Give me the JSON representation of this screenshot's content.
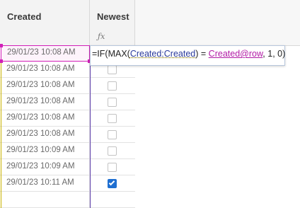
{
  "columns": {
    "created": {
      "label": "Created"
    },
    "newest": {
      "label": "Newest",
      "icon": "fx-formula-icon"
    }
  },
  "rows": [
    {
      "created": "29/01/23 10:08 AM",
      "newest": null
    },
    {
      "created": "29/01/23 10:08 AM",
      "newest": false
    },
    {
      "created": "29/01/23 10:08 AM",
      "newest": false
    },
    {
      "created": "29/01/23 10:08 AM",
      "newest": false
    },
    {
      "created": "29/01/23 10:08 AM",
      "newest": false
    },
    {
      "created": "29/01/23 10:08 AM",
      "newest": false
    },
    {
      "created": "29/01/23 10:09 AM",
      "newest": false
    },
    {
      "created": "29/01/23 10:09 AM",
      "newest": false
    },
    {
      "created": "29/01/23 10:11 AM",
      "newest": true
    },
    {
      "created": "",
      "newest": null
    }
  ],
  "formula": {
    "prefix": "=IF(MAX(",
    "ref1": "Created:Created",
    "middle": ") = ",
    "ref2": "Created@row",
    "suffix": ", 1, 0)"
  },
  "colors": {
    "selection": "#d11fb8",
    "checkbox_checked": "#1f6fd1",
    "column_line_left": "#c9b200",
    "column_line_mid": "#5b3da8"
  }
}
